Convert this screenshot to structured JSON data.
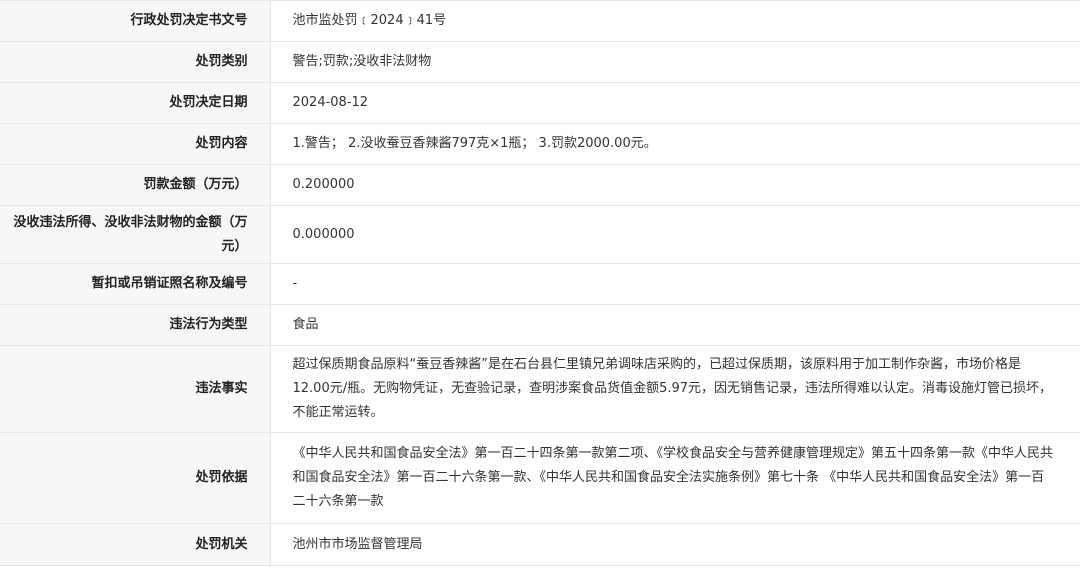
{
  "rows": [
    {
      "label": "行政处罚决定书文号",
      "value": "池市监处罚﹝2024﹞41号"
    },
    {
      "label": "处罚类别",
      "value": "警告;罚款;没收非法财物"
    },
    {
      "label": "处罚决定日期",
      "value": "2024-08-12"
    },
    {
      "label": "处罚内容",
      "value": "1.警告； 2.没收蚕豆香辣酱797克×1瓶； 3.罚款2000.00元。"
    },
    {
      "label": "罚款金额（万元）",
      "value": "0.200000"
    },
    {
      "label": "没收违法所得、没收非法财物的金额（万元）",
      "value": "0.000000"
    },
    {
      "label": "暂扣或吊销证照名称及编号",
      "value": "-"
    },
    {
      "label": "违法行为类型",
      "value": "食品"
    },
    {
      "label": "违法事实",
      "value": "超过保质期食品原料“蚕豆香辣酱”是在石台县仁里镇兄弟调味店采购的，已超过保质期，该原料用于加工制作杂酱，市场价格是12.00元/瓶。无购物凭证，无查验记录，查明涉案食品货值金额5.97元，因无销售记录，违法所得难以认定。消毒设施灯管已损坏，不能正常运转。"
    },
    {
      "label": "处罚依据",
      "value": "《中华人民共和国食品安全法》第一百二十四条第一款第二项、《学校食品安全与营养健康管理规定》第五十四条第一款《中华人民共和国食品安全法》第一百二十六条第一款、《中华人民共和国食品安全法实施条例》第七十条 《中华人民共和国食品安全法》第一百二十六条第一款"
    },
    {
      "label": "处罚机关",
      "value": "池州市市场监督管理局"
    }
  ]
}
